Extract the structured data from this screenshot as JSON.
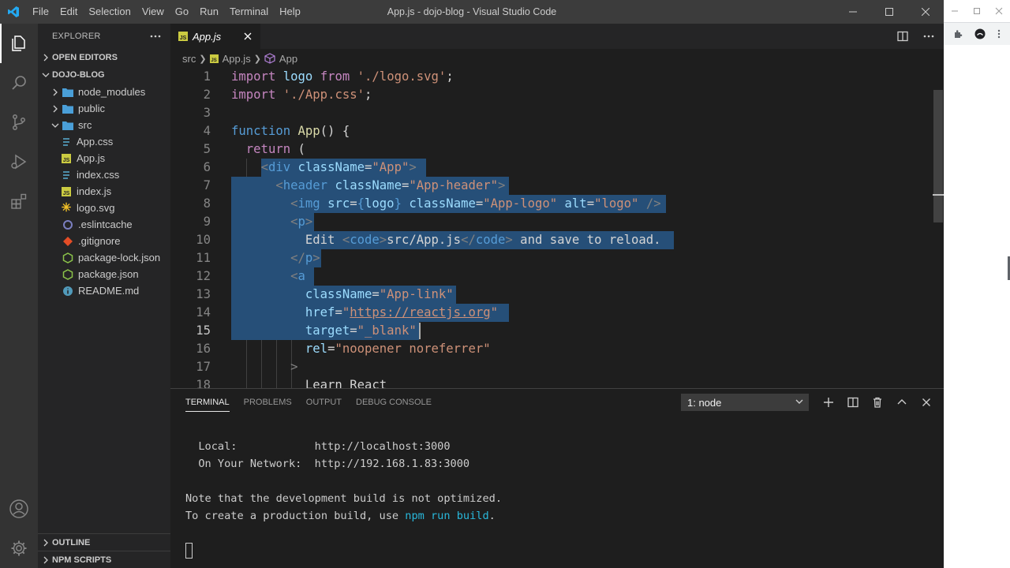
{
  "titlebar": {
    "menu": [
      "File",
      "Edit",
      "Selection",
      "View",
      "Go",
      "Run",
      "Terminal",
      "Help"
    ],
    "window_title": "App.js - dojo-blog - Visual Studio Code"
  },
  "sidebar": {
    "header": "EXPLORER",
    "open_editors": "OPEN EDITORS",
    "project": "DOJO-BLOG",
    "tree": [
      {
        "label": "node_modules",
        "kind": "folder",
        "expanded": false,
        "depth": 1
      },
      {
        "label": "public",
        "kind": "folder",
        "expanded": false,
        "depth": 1
      },
      {
        "label": "src",
        "kind": "folder",
        "expanded": true,
        "depth": 1
      },
      {
        "label": "App.css",
        "kind": "css",
        "depth": 2
      },
      {
        "label": "App.js",
        "kind": "js",
        "depth": 2
      },
      {
        "label": "index.css",
        "kind": "css",
        "depth": 2
      },
      {
        "label": "index.js",
        "kind": "js",
        "depth": 2
      },
      {
        "label": "logo.svg",
        "kind": "svg",
        "depth": 2
      },
      {
        "label": ".eslintcache",
        "kind": "eslint",
        "depth": 1
      },
      {
        "label": ".gitignore",
        "kind": "git",
        "depth": 1
      },
      {
        "label": "package-lock.json",
        "kind": "npm",
        "depth": 1
      },
      {
        "label": "package.json",
        "kind": "npm",
        "depth": 1
      },
      {
        "label": "README.md",
        "kind": "info",
        "depth": 1
      }
    ],
    "outline": "OUTLINE",
    "npm_scripts": "NPM SCRIPTS"
  },
  "editor": {
    "tab_label": "App.js",
    "breadcrumb": [
      "src",
      "App.js",
      "App"
    ],
    "current_line": 15,
    "lines": [
      {
        "n": "1",
        "tokens": [
          [
            "kw",
            "import"
          ],
          [
            "txt",
            " "
          ],
          [
            "attr",
            "logo"
          ],
          [
            "txt",
            " "
          ],
          [
            "kw",
            "from"
          ],
          [
            "txt",
            " "
          ],
          [
            "str",
            "'./logo.svg'"
          ],
          [
            "txt",
            ";"
          ]
        ]
      },
      {
        "n": "2",
        "tokens": [
          [
            "kw",
            "import"
          ],
          [
            "txt",
            " "
          ],
          [
            "str",
            "'./App.css'"
          ],
          [
            "txt",
            ";"
          ]
        ]
      },
      {
        "n": "3",
        "tokens": []
      },
      {
        "n": "4",
        "tokens": [
          [
            "kw2",
            "function"
          ],
          [
            "txt",
            " "
          ],
          [
            "fn",
            "App"
          ],
          [
            "txt",
            "() {"
          ]
        ]
      },
      {
        "n": "5",
        "tokens": [
          [
            "txt",
            "  "
          ],
          [
            "kw",
            "return"
          ],
          [
            "txt",
            " ("
          ]
        ]
      },
      {
        "n": "6",
        "tokens": [
          [
            "txt",
            "    "
          ],
          [
            "br",
            "<"
          ],
          [
            "tag",
            "div"
          ],
          [
            "txt",
            " "
          ],
          [
            "attr",
            "className"
          ],
          [
            "txt",
            "="
          ],
          [
            "str",
            "\"App\""
          ],
          [
            "br",
            ">"
          ]
        ]
      },
      {
        "n": "7",
        "tokens": [
          [
            "txt",
            "      "
          ],
          [
            "br",
            "<"
          ],
          [
            "tag",
            "header"
          ],
          [
            "txt",
            " "
          ],
          [
            "attr",
            "className"
          ],
          [
            "txt",
            "="
          ],
          [
            "str",
            "\"App-header\""
          ],
          [
            "br",
            ">"
          ]
        ]
      },
      {
        "n": "8",
        "tokens": [
          [
            "txt",
            "        "
          ],
          [
            "br",
            "<"
          ],
          [
            "tag",
            "img"
          ],
          [
            "txt",
            " "
          ],
          [
            "attr",
            "src"
          ],
          [
            "txt",
            "="
          ],
          [
            "kw2",
            "{"
          ],
          [
            "attr",
            "logo"
          ],
          [
            "kw2",
            "}"
          ],
          [
            "txt",
            " "
          ],
          [
            "attr",
            "className"
          ],
          [
            "txt",
            "="
          ],
          [
            "str",
            "\"App-logo\""
          ],
          [
            "txt",
            " "
          ],
          [
            "attr",
            "alt"
          ],
          [
            "txt",
            "="
          ],
          [
            "str",
            "\"logo\""
          ],
          [
            "txt",
            " "
          ],
          [
            "br",
            "/>"
          ]
        ]
      },
      {
        "n": "9",
        "tokens": [
          [
            "txt",
            "        "
          ],
          [
            "br",
            "<"
          ],
          [
            "tag",
            "p"
          ],
          [
            "br",
            ">"
          ]
        ]
      },
      {
        "n": "10",
        "tokens": [
          [
            "txt",
            "          Edit "
          ],
          [
            "br",
            "<"
          ],
          [
            "tag",
            "code"
          ],
          [
            "br",
            ">"
          ],
          [
            "txt",
            "src/App.js"
          ],
          [
            "br",
            "</"
          ],
          [
            "tag",
            "code"
          ],
          [
            "br",
            ">"
          ],
          [
            "txt",
            " and save to reload."
          ]
        ]
      },
      {
        "n": "11",
        "tokens": [
          [
            "txt",
            "        "
          ],
          [
            "br",
            "</"
          ],
          [
            "tag",
            "p"
          ],
          [
            "br",
            ">"
          ]
        ]
      },
      {
        "n": "12",
        "tokens": [
          [
            "txt",
            "        "
          ],
          [
            "br",
            "<"
          ],
          [
            "tag",
            "a"
          ]
        ]
      },
      {
        "n": "13",
        "tokens": [
          [
            "txt",
            "          "
          ],
          [
            "attr",
            "className"
          ],
          [
            "txt",
            "="
          ],
          [
            "str",
            "\"App-link\""
          ]
        ]
      },
      {
        "n": "14",
        "tokens": [
          [
            "txt",
            "          "
          ],
          [
            "attr",
            "href"
          ],
          [
            "txt",
            "="
          ],
          [
            "str",
            "\""
          ],
          [
            "strU",
            "https://reactjs.org"
          ],
          [
            "str",
            "\""
          ]
        ]
      },
      {
        "n": "15",
        "tokens": [
          [
            "txt",
            "          "
          ],
          [
            "attr",
            "target"
          ],
          [
            "txt",
            "="
          ],
          [
            "str",
            "\"_blank\""
          ]
        ]
      },
      {
        "n": "16",
        "tokens": [
          [
            "txt",
            "          "
          ],
          [
            "attr",
            "rel"
          ],
          [
            "txt",
            "="
          ],
          [
            "str",
            "\"noopener noreferrer\""
          ]
        ]
      },
      {
        "n": "17",
        "tokens": [
          [
            "txt",
            "        "
          ],
          [
            "br",
            ">"
          ]
        ]
      },
      {
        "n": "18",
        "tokens": [
          [
            "txt",
            "          Learn React"
          ]
        ]
      }
    ]
  },
  "panel": {
    "tabs": [
      "TERMINAL",
      "PROBLEMS",
      "OUTPUT",
      "DEBUG CONSOLE"
    ],
    "active_tab": "TERMINAL",
    "terminal_select": "1: node",
    "terminal_lines": [
      {
        "text": ""
      },
      {
        "text": "  Local:            http://localhost:3000"
      },
      {
        "text": "  On Your Network:  http://192.168.1.83:3000"
      },
      {
        "text": ""
      },
      {
        "text": "Note that the development build is not optimized."
      },
      {
        "text": "To create a production build, use ",
        "cmd": "npm run build",
        "end": "."
      },
      {
        "text": ""
      }
    ]
  }
}
